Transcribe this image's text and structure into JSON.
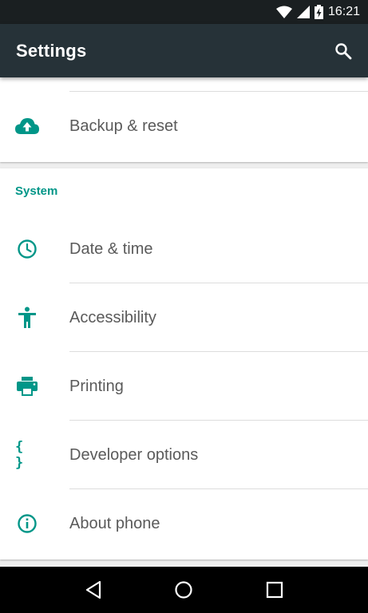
{
  "status_bar": {
    "time": "16:21",
    "icons": [
      "wifi-icon",
      "cell-signal-icon",
      "battery-charging-icon"
    ]
  },
  "app_bar": {
    "title": "Settings",
    "search_icon": "search-icon"
  },
  "top_section": {
    "items": [
      {
        "label": "Backup & reset",
        "icon": "cloud-upload-icon"
      }
    ]
  },
  "system_section": {
    "header": "System",
    "items": [
      {
        "label": "Date & time",
        "icon": "clock-icon"
      },
      {
        "label": "Accessibility",
        "icon": "accessibility-icon"
      },
      {
        "label": "Printing",
        "icon": "printer-icon"
      },
      {
        "label": "Developer options",
        "icon": "braces-icon",
        "glyph": "{ }"
      },
      {
        "label": "About phone",
        "icon": "info-icon"
      }
    ]
  },
  "nav_bar": {
    "buttons": [
      "back-icon",
      "home-icon",
      "recents-icon"
    ]
  },
  "colors": {
    "accent": "#009688",
    "app_bar": "#263238",
    "status_bar": "#1a1f21",
    "text_primary": "#5a5a5a"
  }
}
